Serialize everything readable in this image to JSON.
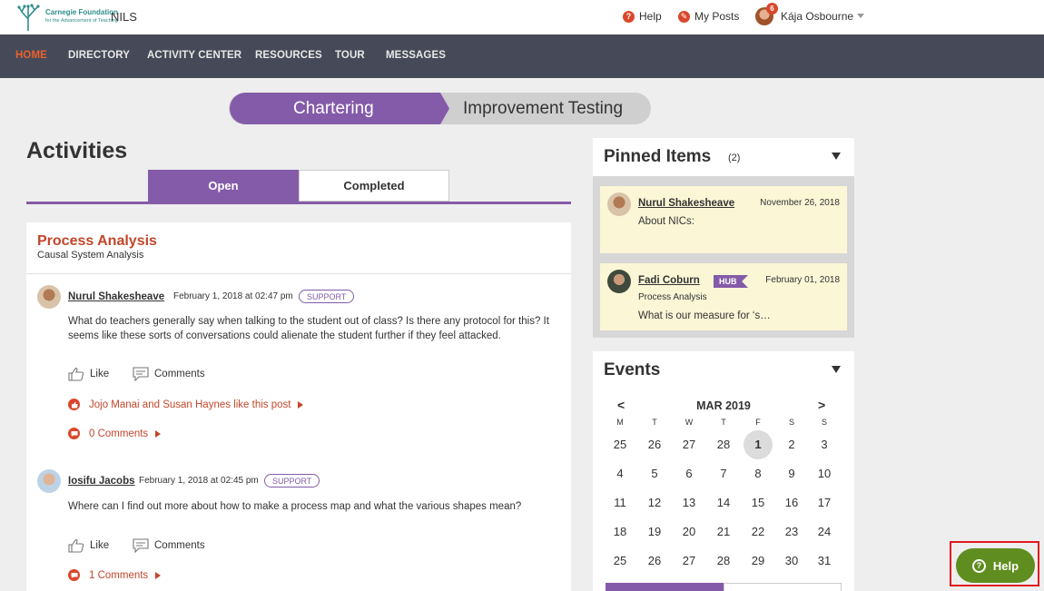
{
  "header": {
    "logo_line1": "Carnegie Foundation",
    "logo_line2": "for the Advancement of Teaching",
    "app_name": "NILS",
    "help_label": "Help",
    "my_posts_label": "My Posts",
    "notification_count": "6",
    "user_name": "Kája Osbourne"
  },
  "nav": {
    "items": [
      "HOME",
      "DIRECTORY",
      "ACTIVITY CENTER",
      "RESOURCES",
      "TOUR",
      "MESSAGES"
    ],
    "active": "HOME"
  },
  "phases": [
    "Chartering",
    "Improvement Testing"
  ],
  "activities": {
    "title": "Activities",
    "tabs": [
      "Open",
      "Completed"
    ],
    "card": {
      "title": "Process Analysis",
      "subtitle": "Causal System Analysis",
      "posts": [
        {
          "author": "Nurul Shakesheave",
          "date": "February 1, 2018 at 02:47 pm",
          "tag": "SUPPORT",
          "body": "What do teachers generally say when talking to the student out of class? Is there any protocol for this? It seems like these sorts of conversations could alienate the student further if they feel attacked.",
          "like_label": "Like",
          "comments_label": "Comments",
          "likes_text": "Jojo Manai and Susan Haynes like this post",
          "comment_count_text": "0 Comments"
        },
        {
          "author": "Iosifu Jacobs",
          "date": "February 1, 2018 at 02:45 pm",
          "tag": "SUPPORT",
          "body": "Where can I find out more about how to make a process map and what the various shapes mean?",
          "like_label": "Like",
          "comments_label": "Comments",
          "comment_count_text": "1 Comments"
        }
      ]
    }
  },
  "pinned": {
    "title": "Pinned Items",
    "count": "(2)",
    "items": [
      {
        "author": "Nurul Shakesheave",
        "date": "November 26, 2018",
        "text": "About NICs:"
      },
      {
        "author": "Fadi Coburn",
        "badge": "HUB",
        "date": "February 01, 2018",
        "context": "Process Analysis",
        "text": "What is our measure for ‘s…"
      }
    ]
  },
  "events": {
    "title": "Events",
    "prev": "<",
    "next": ">",
    "month": "MAR 2019",
    "weekdays": [
      "M",
      "T",
      "W",
      "T",
      "F",
      "S",
      "S"
    ],
    "weeks": [
      [
        "25",
        "26",
        "27",
        "28",
        "1",
        "2",
        "3"
      ],
      [
        "4",
        "5",
        "6",
        "7",
        "8",
        "9",
        "10"
      ],
      [
        "11",
        "12",
        "13",
        "14",
        "15",
        "16",
        "17"
      ],
      [
        "18",
        "19",
        "20",
        "21",
        "22",
        "23",
        "24"
      ],
      [
        "25",
        "26",
        "27",
        "28",
        "29",
        "30",
        "31"
      ]
    ],
    "today": "1"
  },
  "help_widget": {
    "label": "Help"
  },
  "colors": {
    "accent": "#845ba9",
    "nav_bg": "#464a58",
    "nav_active": "#e8612c",
    "title_red": "#c2462a",
    "help_green": "#5f8d1f"
  }
}
